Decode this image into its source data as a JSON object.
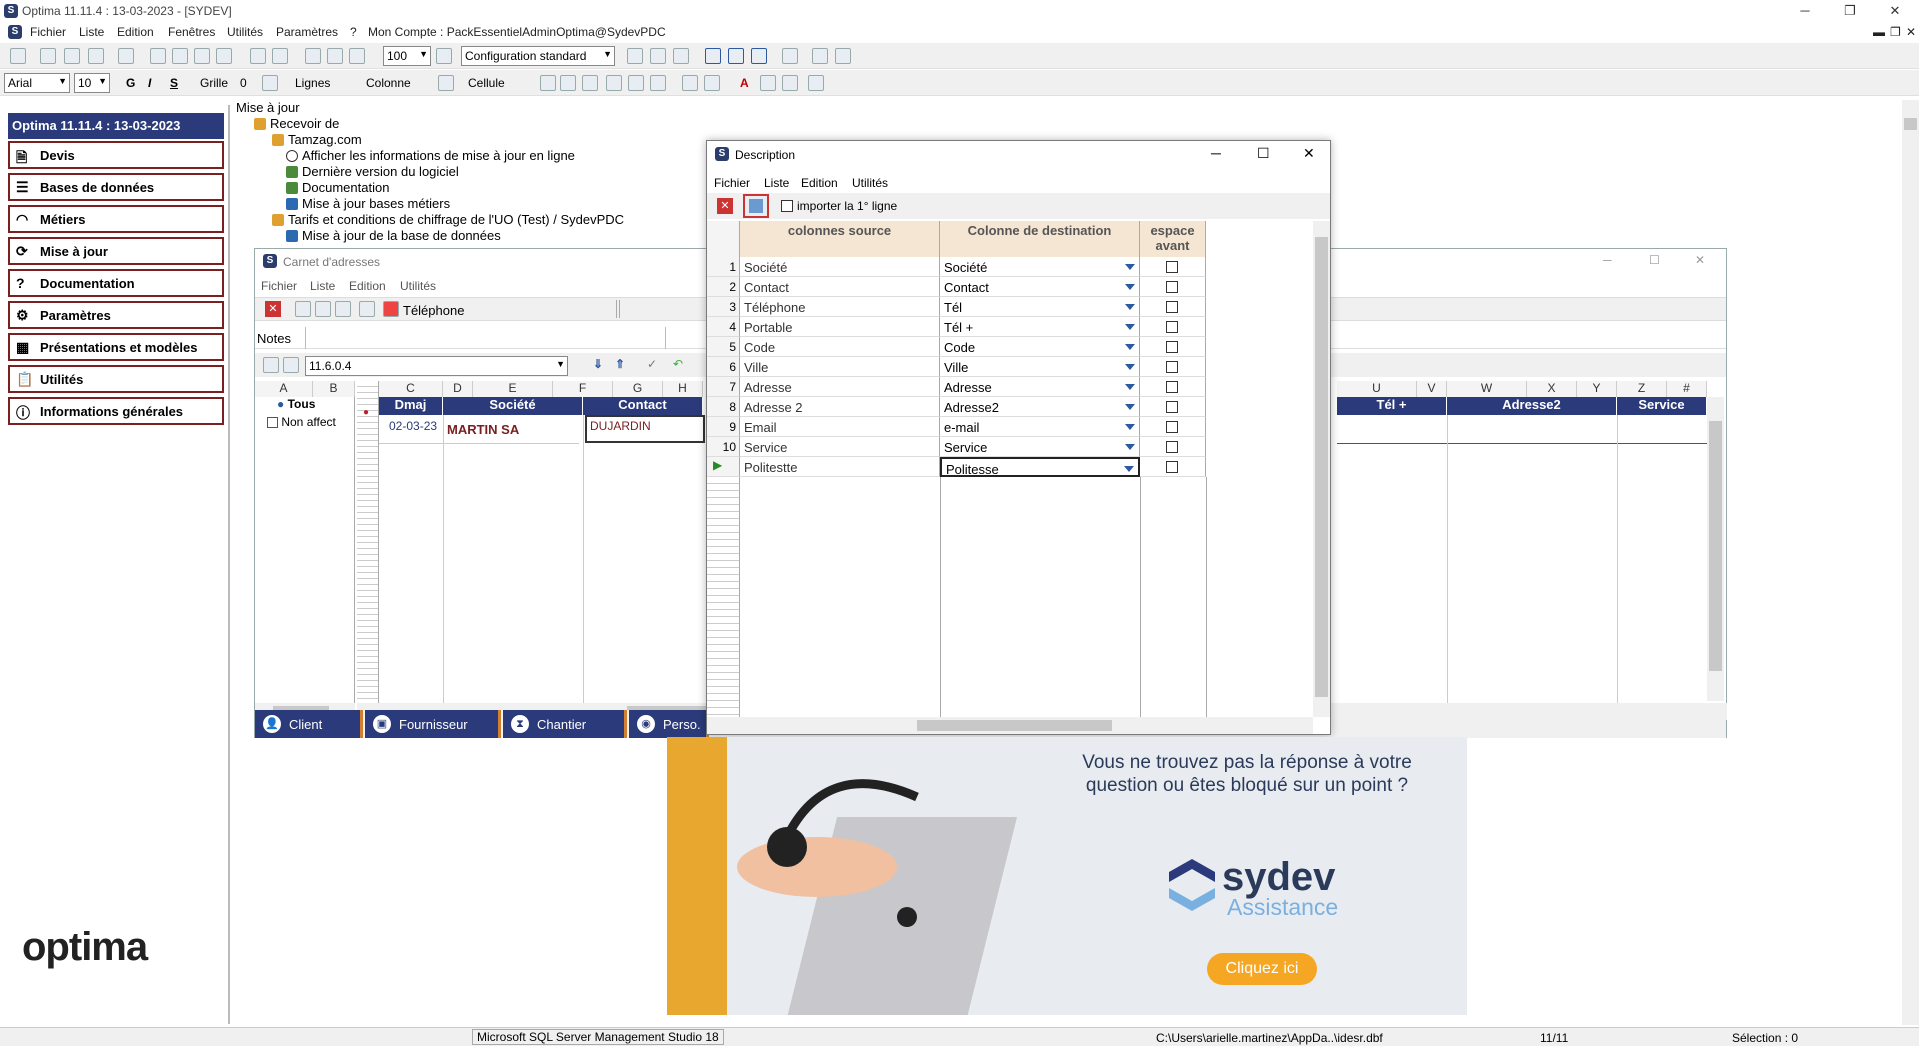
{
  "window": {
    "title": "Optima 11.11.4 : 13-03-2023 - [SYDEV]"
  },
  "menu": [
    "Fichier",
    "Liste",
    "Edition",
    "Fenêtres",
    "Utilités",
    "Paramètres",
    "?",
    "Mon Compte : PackEssentielAdminOptima@SydevPDC"
  ],
  "toolbar1": {
    "zoom": "100",
    "config": "Configuration standard"
  },
  "toolbar2": {
    "font": "Arial",
    "size": "10",
    "grille_label": "Grille",
    "grille_value": "0",
    "lignes_label": "Lignes",
    "colonne_label": "Colonne",
    "cellule_label": "Cellule"
  },
  "leftpanel": {
    "title": "Optima 11.11.4 : 13-03-2023",
    "items": [
      "Devis",
      "Bases de données",
      "Métiers",
      "Mise à jour",
      "Documentation",
      "Paramètres",
      "Présentations et modèles",
      "Utilités",
      "Informations générales"
    ],
    "logo": "optima"
  },
  "tree": {
    "root": "Mise à jour",
    "recevoir": "Recevoir de",
    "tamzag": "Tamzag.com",
    "afficher": "Afficher les informations de mise à jour en ligne",
    "derniere": "Dernière version du logiciel",
    "documentation": "Documentation",
    "bases": "Mise à jour bases métiers",
    "tarifs": "Tarifs et conditions de chiffrage de l'UO (Test) / SydevPDC",
    "base_donnees": "Mise à jour de la base de données"
  },
  "carnet": {
    "title": "Carnet d'adresses",
    "menu": [
      "Fichier",
      "Liste",
      "Edition",
      "Utilités"
    ],
    "toolbar_label": "Téléphone",
    "notes_label": "Notes",
    "version": "11.6.0.4",
    "filters": [
      "Tous",
      "Non affect"
    ],
    "col_letters_left": [
      "A",
      "B"
    ],
    "col_letters": [
      "C",
      "D",
      "E",
      "F",
      "G",
      "H"
    ],
    "col_letters_right": [
      "U",
      "V",
      "W",
      "X",
      "Y",
      "Z",
      "#"
    ],
    "headers_left": [
      "Dmaj",
      "Société",
      "Contact"
    ],
    "headers_right": [
      "Tél +",
      "Adresse2",
      "Service"
    ],
    "row": {
      "date": "02-03-23",
      "societe": "MARTIN SA",
      "contact": "DUJARDIN"
    },
    "tabs": [
      "Client",
      "Fournisseur",
      "Chantier",
      "Perso."
    ]
  },
  "desc": {
    "title": "Description",
    "menu": [
      "Fichier",
      "Liste",
      "Edition",
      "Utilités"
    ],
    "import_label": "importer la 1° ligne",
    "headers": [
      "colonnes source",
      "Colonne de destination",
      "espace avant"
    ],
    "rows": [
      {
        "n": "1",
        "src": "Société",
        "dst": "Société"
      },
      {
        "n": "2",
        "src": "Contact",
        "dst": "Contact"
      },
      {
        "n": "3",
        "src": "Téléphone",
        "dst": "Tél"
      },
      {
        "n": "4",
        "src": "Portable",
        "dst": "Tél +"
      },
      {
        "n": "5",
        "src": "Code",
        "dst": "Code"
      },
      {
        "n": "6",
        "src": "Ville",
        "dst": "Ville"
      },
      {
        "n": "7",
        "src": "Adresse",
        "dst": "Adresse"
      },
      {
        "n": "8",
        "src": "Adresse 2",
        "dst": "Adresse2"
      },
      {
        "n": "9",
        "src": "Email",
        "dst": "e-mail"
      },
      {
        "n": "10",
        "src": "Service",
        "dst": "Service"
      },
      {
        "n": "",
        "src": "Politestte",
        "dst": "Politesse"
      }
    ]
  },
  "ad": {
    "question": "Vous ne trouvez pas la réponse à votre question ou êtes bloqué sur un point ?",
    "brand": "sydev",
    "sub": "Assistance",
    "button": "Cliquez ici"
  },
  "status": {
    "app": "Microsoft SQL Server Management Studio 18",
    "path": "C:\\Users\\arielle.martinez\\AppDa..\\idesr.dbf",
    "count": "11/11",
    "selection": "Sélection : 0"
  },
  "colors": {
    "navy": "#2b3a7a",
    "accent_red": "#7a2020",
    "orange": "#f5a623"
  }
}
